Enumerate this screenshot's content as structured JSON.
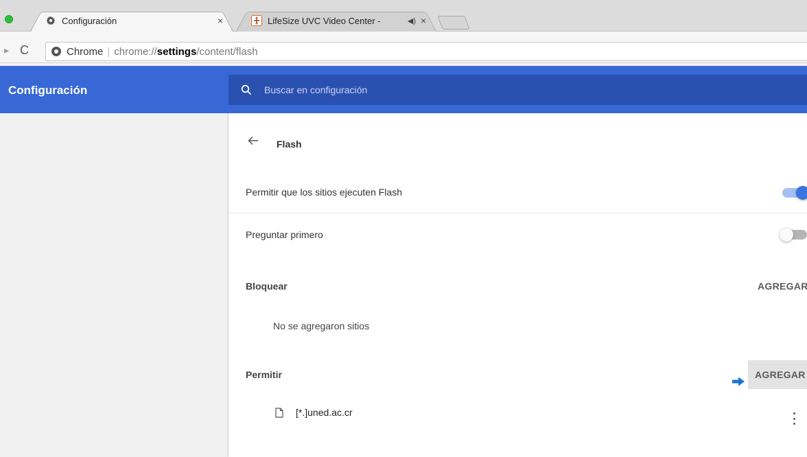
{
  "browser": {
    "tabs": [
      {
        "title": "Configuración",
        "favicon": "gear-icon",
        "active": true
      },
      {
        "title": "LifeSize UVC Video Center -",
        "favicon": "lifesize-icon",
        "active": false,
        "audio": "speaker-icon"
      }
    ],
    "omnibox": {
      "chip": "Chrome",
      "url_scheme": "chrome://",
      "url_host": "settings",
      "url_path": "/content/flash"
    }
  },
  "settings": {
    "app_title": "Configuración",
    "search_placeholder": "Buscar en configuración",
    "page_title": "Flash",
    "allow_flash": {
      "label": "Permitir que los sitios ejecuten Flash",
      "enabled": true
    },
    "ask_first": {
      "label": "Preguntar primero",
      "enabled": false
    },
    "block": {
      "label": "Bloquear",
      "add_label": "AGREGAR",
      "empty_text": "No se agregaron sitios"
    },
    "allow": {
      "label": "Permitir",
      "add_label": "AGREGAR",
      "sites": [
        "[*.]uned.ac.cr"
      ]
    }
  },
  "colors": {
    "header_blue": "#3768d6",
    "search_blue": "#2a50b0",
    "toggle_on": "#3a74e0",
    "annotation_arrow": "#1a73d9"
  }
}
